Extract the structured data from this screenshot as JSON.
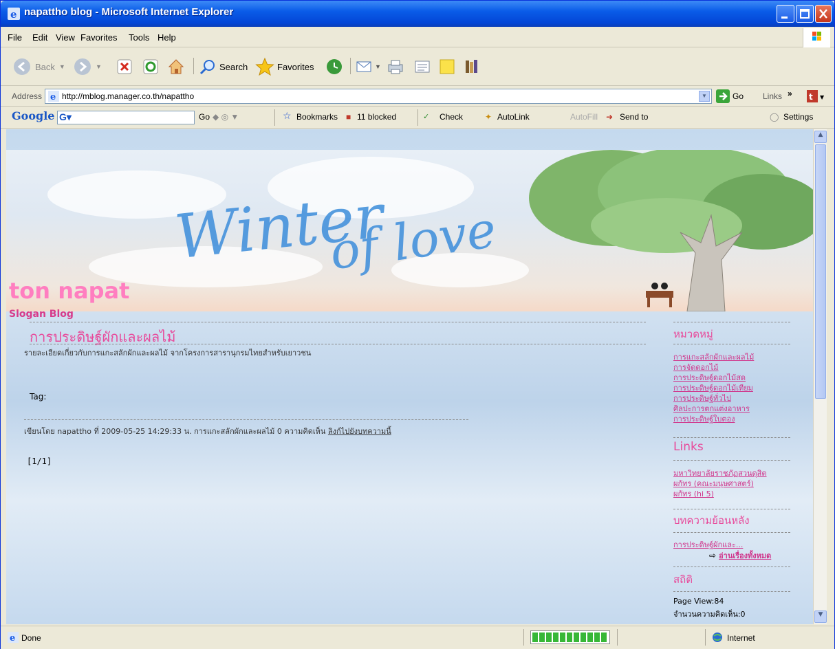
{
  "window": {
    "title": "napattho blog - Microsoft Internet Explorer"
  },
  "menu": [
    "File",
    "Edit",
    "View",
    "Favorites",
    "Tools",
    "Help"
  ],
  "toolbar": {
    "back": "Back",
    "search": "Search",
    "favorites": "Favorites"
  },
  "address": {
    "label": "Address",
    "url": "http://mblog.manager.co.th/napattho",
    "go": "Go",
    "links": "Links"
  },
  "googlebar": {
    "brand": "Google",
    "go": "Go",
    "bookmarks": "Bookmarks",
    "blocked": "11 blocked",
    "check": "Check",
    "autolink": "AutoLink",
    "autofill": "AutoFill",
    "sendto": "Send to",
    "settings": "Settings"
  },
  "blog": {
    "banner_text1": "Winter",
    "banner_text2": "of love",
    "title": "ton napat",
    "slogan": "Slogan Blog"
  },
  "post": {
    "title": "การประดิษฐ์ผักและผลไม้",
    "description": "รายละเอียดเกี่ยวกับการแกะสลักผักและผลไม้  จากโครงการสารานุกรมไทยสำหรับเยาวชน",
    "tag_label": "Tag:",
    "byline": "เขียนโดย napattho ที่ 2009-05-25 14:29:33 น. การแกะสลักผักและผลไม้ 0 ความคิดเห็น",
    "permalink": "ลิงก์ไปยังบทความนี้",
    "pager": "[1/1]"
  },
  "sidebar": {
    "categories_heading": "หมวดหมู่",
    "categories": [
      "การแกะสลักผักและผลไม้",
      "การจัดดอกไม้",
      "การประดิษฐ์ดอกไม้สด",
      "การประดิษฐ์ดอกไม้เทียม",
      "การประดิษฐ์ทั่วไป",
      "ศิลปะการตกแต่งอาหาร",
      "การประดิษฐ์ใบตอง"
    ],
    "links_heading": "Links",
    "links": [
      "มหาวิทยาลัยราชภัฏสวนดุสิต",
      "ผกัทร (คณะมนุษศาสตร์)",
      "ผกัทร (hi 5)"
    ],
    "archive_heading": "บทความย้อนหลัง",
    "archive": [
      "การประดิษฐ์ผักและ..."
    ],
    "read_all": "อ่านเรื่องทั้งหมด",
    "stats_heading": "สถิติ",
    "page_view": "Page View:84",
    "comment_count": "จำนวนความคิดเห็น:0"
  },
  "status": {
    "text": "Done",
    "zone": "Internet"
  },
  "colors": {
    "titlebar": "#0346d6",
    "pink": "#e8499a",
    "link": "#d0358b"
  }
}
